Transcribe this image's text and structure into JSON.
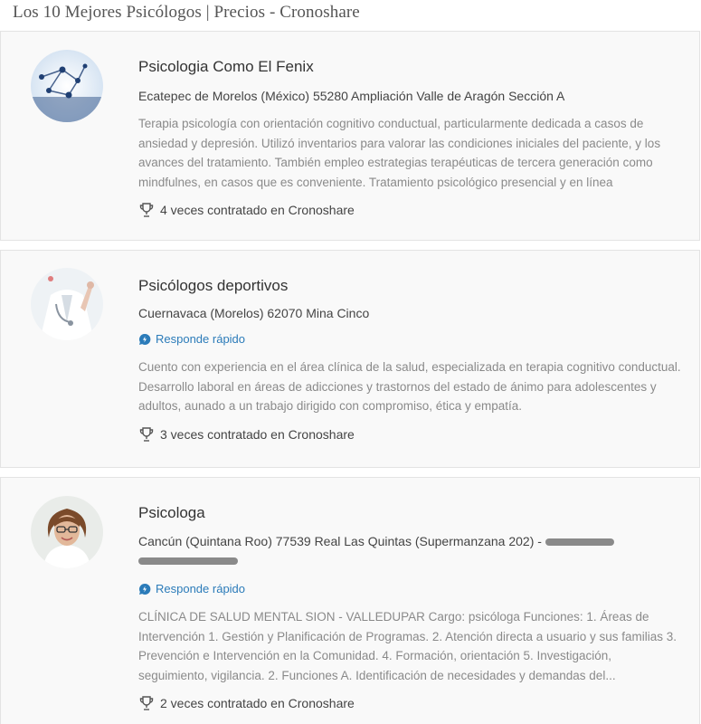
{
  "page": {
    "title": "Los 10 Mejores Psicólogos | Precios - Cronoshare"
  },
  "listings": [
    {
      "title": "Psicologia Como El Fenix",
      "location": "Ecatepec de Morelos (México) 55280 Ampliación Valle de Aragón Sección A",
      "description": "Terapia psicología con orientación cognitivo conductual, particularmente dedicada a casos de ansiedad y depresión. Utilizó inventarios para valorar las condiciones iniciales del paciente, y los avances del tratamiento. También empleo estrategias terapéuticas de tercera generación como mindfulnes, en casos que es conveniente. Tratamiento psicológico presencial y en línea",
      "hired": "4 veces contratado en Cronoshare"
    },
    {
      "title": "Psicólogos deportivos",
      "location": "Cuernavaca (Morelos) 62070 Mina Cinco",
      "badge": "Responde rápido",
      "description": "Cuento con experiencia en el área clínica de la salud, especializada en terapia cognitivo conductual. Desarrollo laboral en áreas de adicciones y trastornos del estado de ánimo para adolescentes y adultos, aunado a un trabajo dirigido con compromiso, ética y empatía.",
      "hired": "3 veces contratado en Cronoshare"
    },
    {
      "title": "Psicologa",
      "location": "Cancún (Quintana Roo) 77539 Real Las Quintas (Supermanzana 202) -",
      "badge": "Responde rápido",
      "description": "CLÍNICA DE SALUD MENTAL SION - VALLEDUPAR Cargo: psicóloga Funciones: 1. Áreas de Intervención 1. Gestión y Planificación de Programas. 2. Atención directa a usuario y sus familias 3. Prevención e Intervención en la Comunidad. 4. Formación, orientación 5. Investigación, seguimiento, vigilancia. 2. Funciones A. Identificación de necesidades y demandas del...",
      "hired": "2 veces contratado en Cronoshare"
    }
  ],
  "icons": {
    "trophy": "trophy-icon",
    "badge": "speech-bubble-icon"
  },
  "colors": {
    "badge": "#2b7bb9",
    "description": "#8a8a8a",
    "card_background": "#f9f9f9"
  }
}
